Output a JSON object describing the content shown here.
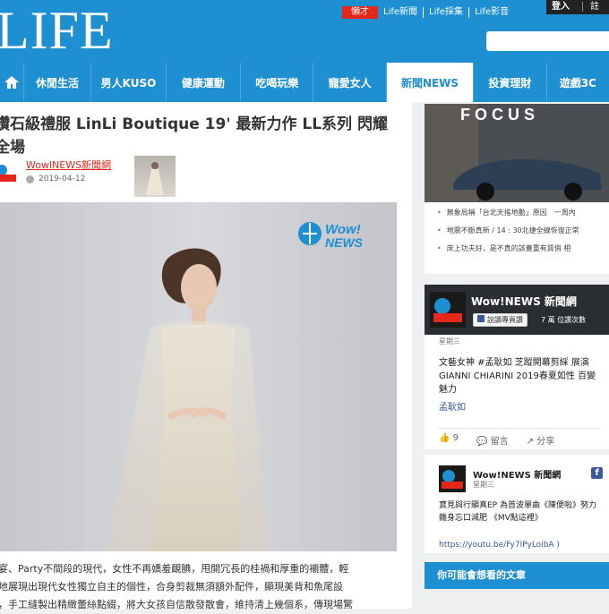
{
  "header": {
    "logo_text": "LIFE",
    "hot_label": "懶才",
    "links": [
      "Life新聞",
      "Life採集",
      "Life影音"
    ],
    "login": "登入",
    "extra": "註"
  },
  "nav": {
    "items": [
      "休閒生活",
      "男人KUSO",
      "健康運動",
      "吃喝玩樂",
      "寵愛女人",
      "新聞NEWS",
      "投資理財",
      "遊戲3C"
    ],
    "active_index": 5
  },
  "article": {
    "title": "鑽石級禮服 LinLi Boutique 19' 最新力作 LL系列 閃耀全場",
    "author": "WowlNEWS新聞網",
    "date": "2019-04-12",
    "watermark": "Wow! NEWS",
    "body": [
      "宴、Party不間段的現代，女性不再嬌羞靦腆，甩開冗長的桂禍和厚重的襯體，輕",
      "地展現出現代女性獨立自主的個性，合身剪裁無須額外配件，顯現美背和魚尾設",
      "，手工縫製出精緻蕾絲點綴，將大女孩自信散發散會，維持清上幾個系，傳現場驚"
    ]
  },
  "sidebar": {
    "ad_brand": "FOCUS",
    "news": [
      "無象局稱「台北天搖地動」原因　一周內",
      "地震不斷真新 / 14 : 30北捷全線恢復正常",
      "床上功夫好，是不真的該蓋重有質俏 相"
    ],
    "fb_page": {
      "name": "Wow!NEWS 新聞網",
      "like_label": "說讀專頁讚",
      "likes": "7 萬 位讚次數",
      "day": "星期三",
      "post": "文藝女神 #孟耿如 芝蹤開幕剪綵 展演 GIANNI CHIARINI 2019春夏如性 百變魅力",
      "tag": "孟耿如",
      "reactions": "9",
      "comment_label": "留言",
      "share_label": "分享"
    },
    "fb_post2": {
      "name": "Wow!NEWS 新聞網",
      "day": "星期三",
      "text": "寶見與行顯真EP 為首波單曲《陳便啦》努力雜身忘口減肥 《MV點這裡》",
      "link": "https://youtu.be/Fy7lPyLoibA )"
    },
    "suggest_title": "你可能會想看的文章"
  }
}
